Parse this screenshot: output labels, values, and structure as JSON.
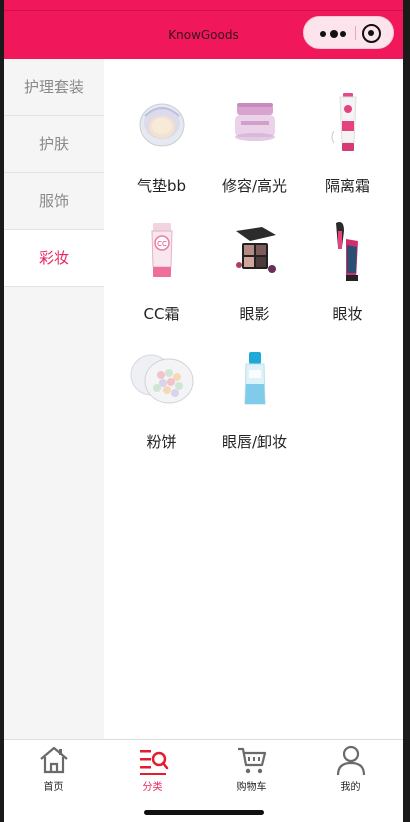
{
  "app": {
    "title": "KnowGoods"
  },
  "colors": {
    "brand": "#f0185a",
    "active_text": "#e8265e",
    "sidebar_bg": "#f5f5f5"
  },
  "sidebar": {
    "items": [
      {
        "label": "护理套装",
        "active": false
      },
      {
        "label": "护肤",
        "active": false
      },
      {
        "label": "服饰",
        "active": false
      },
      {
        "label": "彩妆",
        "active": true
      }
    ]
  },
  "products": [
    {
      "label": "气垫bb",
      "icon": "cushion-compact-icon"
    },
    {
      "label": "修容/高光",
      "icon": "cream-jar-icon"
    },
    {
      "label": "隔离霜",
      "icon": "primer-tube-icon"
    },
    {
      "label": "CC霜",
      "icon": "cc-cream-tube-icon"
    },
    {
      "label": "眼影",
      "icon": "eyeshadow-palette-icon"
    },
    {
      "label": "眼妆",
      "icon": "mascara-icon"
    },
    {
      "label": "粉饼",
      "icon": "powder-pearls-icon"
    },
    {
      "label": "眼唇/卸妆",
      "icon": "remover-bottle-icon"
    }
  ],
  "tabbar": {
    "items": [
      {
        "label": "首页",
        "icon": "home-icon",
        "active": false
      },
      {
        "label": "分类",
        "icon": "category-icon",
        "active": true
      },
      {
        "label": "购物车",
        "icon": "cart-icon",
        "active": false
      },
      {
        "label": "我的",
        "icon": "user-icon",
        "active": false
      }
    ]
  }
}
